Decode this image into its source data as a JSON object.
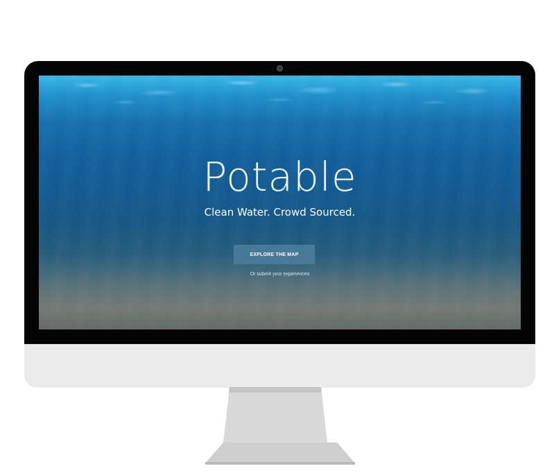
{
  "hero": {
    "title": "Potable",
    "tagline": "Clean Water. Crowd Sourced.",
    "cta_label": "EXPLORE THE MAP",
    "secondary_link": "Or submit your experiences"
  },
  "colors": {
    "bezel": "#050505",
    "chin": "#ebebeb",
    "stand": "#d9d9d9",
    "water_top": "#38b6e6",
    "water_mid": "#135a93",
    "button": "#4b7d9b",
    "text": "#ffffff"
  }
}
